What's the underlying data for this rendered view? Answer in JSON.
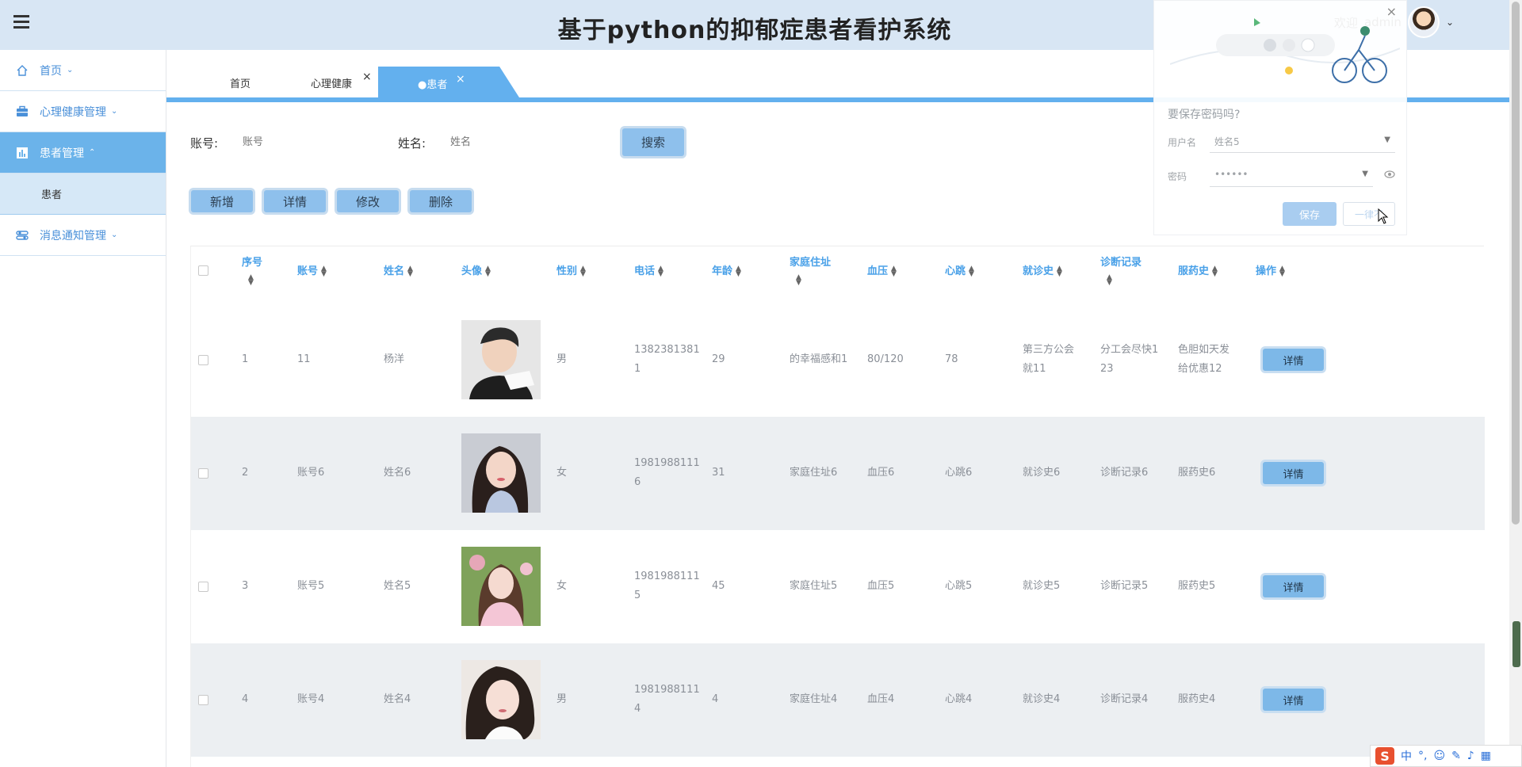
{
  "header": {
    "title": "基于python的抑郁症患者看护系统",
    "welcome": "欢迎",
    "username": "admin"
  },
  "sidebar": {
    "items": [
      {
        "label": "首页",
        "icon": "home-icon"
      },
      {
        "label": "心理健康管理",
        "icon": "briefcase-icon"
      },
      {
        "label": "患者管理",
        "icon": "chart-icon"
      },
      {
        "label": "患者",
        "icon": ""
      },
      {
        "label": "消息通知管理",
        "icon": "sliders-icon"
      }
    ]
  },
  "tabs": [
    {
      "label": "首页"
    },
    {
      "label": "心理健康"
    },
    {
      "label": "●患者"
    }
  ],
  "search": {
    "account_label": "账号:",
    "account_placeholder": "账号",
    "name_label": "姓名:",
    "name_placeholder": "姓名",
    "button": "搜索"
  },
  "toolbar": {
    "add": "新增",
    "detail": "详情",
    "edit": "修改",
    "delete": "删除"
  },
  "table": {
    "headers": [
      "序号",
      "账号",
      "姓名",
      "头像",
      "性别",
      "电话",
      "年龄",
      "家庭住址",
      "血压",
      "心跳",
      "就诊史",
      "诊断记录",
      "服药史",
      "操作"
    ],
    "rows": [
      {
        "index": "1",
        "account": "11",
        "name": "杨洋",
        "gender": "男",
        "phone_a": "1382381381",
        "phone_b": "1",
        "age": "29",
        "address": "的幸福感和1",
        "bp": "80/120",
        "heart": "78",
        "history_a": "第三方公会",
        "history_b": "就11",
        "diag_a": "分工会尽快1",
        "diag_b": "23",
        "med_a": "色胆如天发",
        "med_b": "给优惠12",
        "action": "详情"
      },
      {
        "index": "2",
        "account": "账号6",
        "name": "姓名6",
        "gender": "女",
        "phone_a": "1981988111",
        "phone_b": "6",
        "age": "31",
        "address": "家庭住址6",
        "bp": "血压6",
        "heart": "心跳6",
        "history_a": "就诊史6",
        "history_b": "",
        "diag_a": "诊断记录6",
        "diag_b": "",
        "med_a": "服药史6",
        "med_b": "",
        "action": "详情"
      },
      {
        "index": "3",
        "account": "账号5",
        "name": "姓名5",
        "gender": "女",
        "phone_a": "1981988111",
        "phone_b": "5",
        "age": "45",
        "address": "家庭住址5",
        "bp": "血压5",
        "heart": "心跳5",
        "history_a": "就诊史5",
        "history_b": "",
        "diag_a": "诊断记录5",
        "diag_b": "",
        "med_a": "服药史5",
        "med_b": "",
        "action": "详情"
      },
      {
        "index": "4",
        "account": "账号4",
        "name": "姓名4",
        "gender": "男",
        "phone_a": "1981988111",
        "phone_b": "4",
        "age": "4",
        "address": "家庭住址4",
        "bp": "血压4",
        "heart": "心跳4",
        "history_a": "就诊史4",
        "history_b": "",
        "diag_a": "诊断记录4",
        "diag_b": "",
        "med_a": "服药史4",
        "med_b": "",
        "action": "详情"
      }
    ]
  },
  "password_popup": {
    "title": "要保存密码吗?",
    "username_label": "用户名",
    "username_value": "姓名5",
    "password_label": "密码",
    "password_value": "••••••",
    "save": "保存",
    "never": "一律不"
  },
  "ime": {
    "logo": "S",
    "mode": "中"
  },
  "colors": {
    "header_bg": "#d8e6f4",
    "accent": "#63b0ee",
    "sidebar_text": "#4a90d9",
    "table_header": "#4aa1e8",
    "button_bg": "#8ec0ec"
  }
}
